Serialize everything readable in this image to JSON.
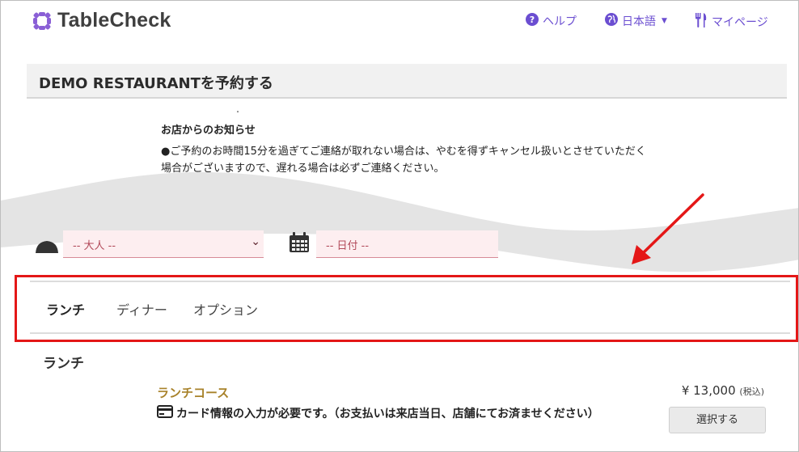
{
  "header": {
    "brand": "TableCheck",
    "nav": {
      "help": "ヘルプ",
      "language": "日本語",
      "mypage": "マイページ"
    }
  },
  "page": {
    "title": "DEMO RESTAURANTを予約する"
  },
  "notice": {
    "dot": "・",
    "heading": "お店からのお知らせ",
    "body": "●ご予約のお時間15分を過ぎてご連絡が取れない場合は、やむを得ずキャンセル扱いとさせていただく場合がございますので、遅れる場合は必ずご連絡ください。"
  },
  "selectors": {
    "people_placeholder": "-- 大人 --",
    "date_placeholder": "-- 日付 --"
  },
  "tabs": [
    {
      "label": "ランチ",
      "active": true
    },
    {
      "label": "ディナー",
      "active": false
    },
    {
      "label": "オプション",
      "active": false
    }
  ],
  "section": {
    "title": "ランチ"
  },
  "course": {
    "name": "ランチコース",
    "card_note": "カード情報の入力が必要です。（お支払いは来店当日、店舗にてお済ませください）",
    "price": "¥ 13,000",
    "tax_note": "(税込)",
    "select_label": "選択する"
  },
  "colors": {
    "brand_purple": "#6b4ed1",
    "course_gold": "#a8822a",
    "highlight_red": "#e41717",
    "select_pink": "#fdeef0"
  },
  "icons": [
    "logo-icon",
    "help-icon",
    "globe-icon",
    "fork-knife-icon",
    "person-icon",
    "calendar-icon",
    "credit-card-icon",
    "chevron-down-icon",
    "annotation-arrow"
  ]
}
